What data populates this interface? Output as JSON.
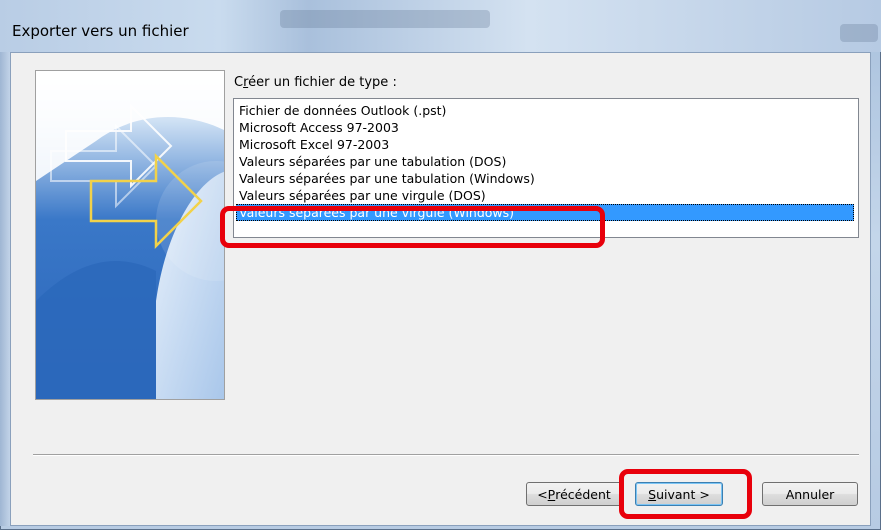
{
  "window": {
    "title": "Exporter vers un fichier"
  },
  "main": {
    "type_label_prefix": "C",
    "type_label_mnemonic": "r",
    "type_label_suffix": "éer un fichier de type :",
    "items": [
      "Fichier de données Outlook (.pst)",
      "Microsoft Access 97-2003",
      "Microsoft Excel 97-2003",
      "Valeurs séparées par une tabulation (DOS)",
      "Valeurs séparées par une tabulation (Windows)",
      "Valeurs séparées par une virgule (DOS)",
      "Valeurs séparées par une virgule (Windows)"
    ],
    "selected_index": 6
  },
  "buttons": {
    "back_prefix": "< ",
    "back_mnemonic": "P",
    "back_suffix": "récédent",
    "next_mnemonic": "S",
    "next_suffix": "uivant >",
    "cancel_label": "Annuler"
  },
  "colors": {
    "selection": "#3399ff",
    "highlight": "#e8000b"
  }
}
